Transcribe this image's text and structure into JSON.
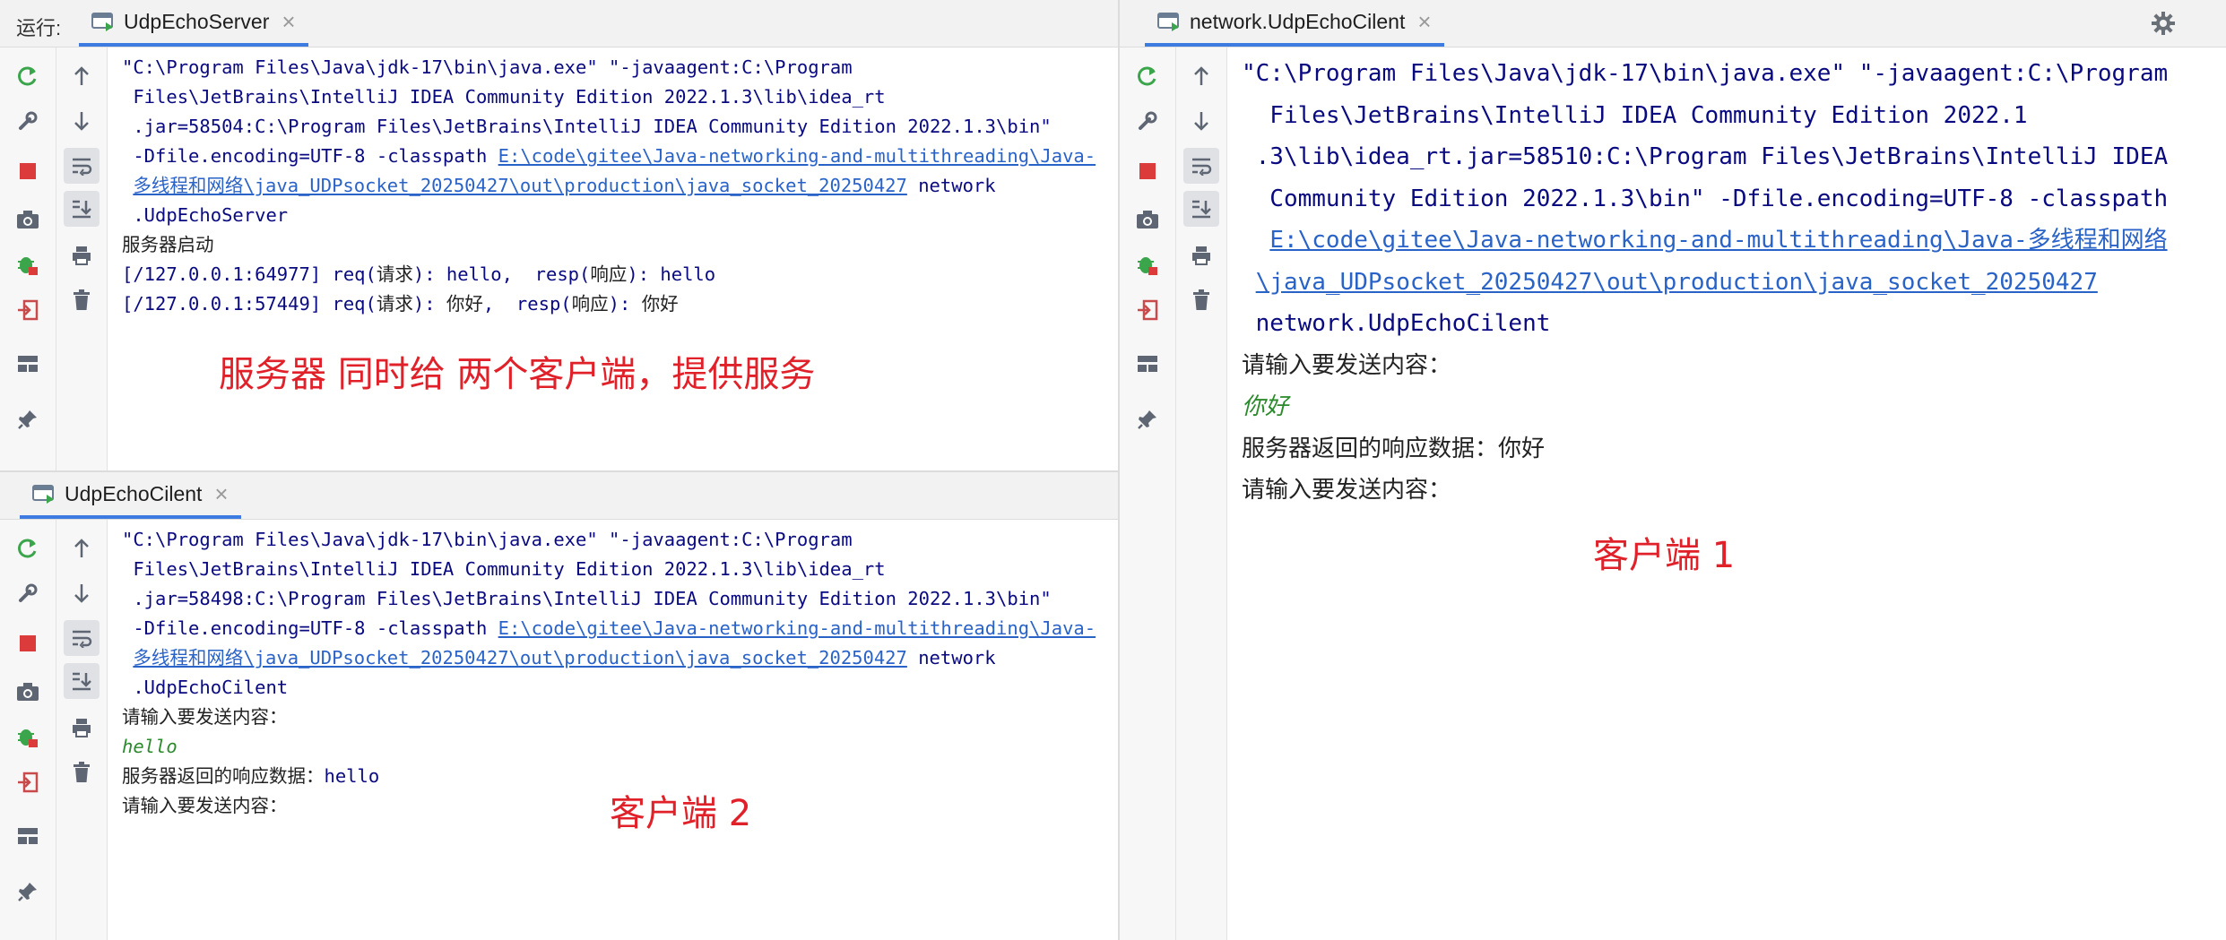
{
  "server_panel": {
    "run_label": "运行:",
    "tab_title": "UdpEchoServer",
    "console_lines": [
      [
        {
          "t": "\"C:\\Program Files\\Java\\jdk-17\\bin\\java.exe\" \"-javaagent:C:\\Program"
        }
      ],
      [
        {
          "t": " Files\\JetBrains\\IntelliJ IDEA Community Edition 2022.1.3\\lib\\idea_rt"
        }
      ],
      [
        {
          "t": " .jar=58504:C:\\Program Files\\JetBrains\\IntelliJ IDEA Community Edition 2022.1.3\\bin\""
        }
      ],
      [
        {
          "t": " -Dfile.encoding=UTF-8 -classpath "
        },
        {
          "t": "E:\\code\\gitee\\Java-networking-and-multithreading\\Java-",
          "c": "link"
        }
      ],
      [
        {
          "t": " "
        },
        {
          "t": "多线程和网络\\java_UDPsocket_20250427\\out\\production\\java_socket_20250427",
          "c": "link"
        },
        {
          "t": " network"
        }
      ],
      [
        {
          "t": " .UdpEchoServer"
        }
      ],
      [
        {
          "t": "服务器启动",
          "c": "cn"
        }
      ],
      [
        {
          "t": "[/127.0.0.1:64977] req(",
          "c": "plain"
        },
        {
          "t": "请求",
          "c": "cn"
        },
        {
          "t": "): hello,  resp(",
          "c": "plain"
        },
        {
          "t": "响应",
          "c": "cn"
        },
        {
          "t": "): hello",
          "c": "plain"
        }
      ],
      [
        {
          "t": "[/127.0.0.1:57449] req(",
          "c": "plain"
        },
        {
          "t": "请求",
          "c": "cn"
        },
        {
          "t": "): ",
          "c": "plain"
        },
        {
          "t": "你好",
          "c": "cn"
        },
        {
          "t": ",  resp(",
          "c": "plain"
        },
        {
          "t": "响应",
          "c": "cn"
        },
        {
          "t": "): ",
          "c": "plain"
        },
        {
          "t": "你好",
          "c": "cn"
        }
      ]
    ],
    "annotation": "服务器 同时给 两个客户端，提供服务"
  },
  "client2_panel": {
    "tab_title": "UdpEchoCilent",
    "console_lines": [
      [
        {
          "t": "\"C:\\Program Files\\Java\\jdk-17\\bin\\java.exe\" \"-javaagent:C:\\Program"
        }
      ],
      [
        {
          "t": " Files\\JetBrains\\IntelliJ IDEA Community Edition 2022.1.3\\lib\\idea_rt"
        }
      ],
      [
        {
          "t": " .jar=58498:C:\\Program Files\\JetBrains\\IntelliJ IDEA Community Edition 2022.1.3\\bin\""
        }
      ],
      [
        {
          "t": " -Dfile.encoding=UTF-8 -classpath "
        },
        {
          "t": "E:\\code\\gitee\\Java-networking-and-multithreading\\Java-",
          "c": "link"
        }
      ],
      [
        {
          "t": " "
        },
        {
          "t": "多线程和网络\\java_UDPsocket_20250427\\out\\production\\java_socket_20250427",
          "c": "link"
        },
        {
          "t": " network"
        }
      ],
      [
        {
          "t": " .UdpEchoCilent"
        }
      ],
      [
        {
          "t": "请输入要发送内容：",
          "c": "cn"
        }
      ],
      [
        {
          "t": "hello",
          "c": "green"
        }
      ],
      [
        {
          "t": "服务器返回的响应数据：",
          "c": "cn"
        },
        {
          "t": "hello",
          "c": "plain"
        }
      ],
      [
        {
          "t": "请输入要发送内容：",
          "c": "cn"
        }
      ]
    ],
    "annotation": "客户端 2"
  },
  "client1_panel": {
    "tab_title": "network.UdpEchoCilent",
    "console_lines": [
      [
        {
          "t": "\"C:\\Program Files\\Java\\jdk-17\\bin\\java.exe\" \"-javaagent:C:\\Program"
        }
      ],
      [
        {
          "t": "  Files\\JetBrains\\IntelliJ IDEA Community Edition 2022.1"
        }
      ],
      [
        {
          "t": " .3\\lib\\idea_rt.jar=58510:C:\\Program Files\\JetBrains\\IntelliJ IDEA"
        }
      ],
      [
        {
          "t": "  Community Edition 2022.1.3\\bin\" -Dfile.encoding=UTF-8 -classpath"
        }
      ],
      [
        {
          "t": "  "
        },
        {
          "t": "E:\\code\\gitee\\Java-networking-and-multithreading\\Java-多线程和网络",
          "c": "link"
        }
      ],
      [
        {
          "t": " "
        },
        {
          "t": "\\java_UDPsocket_20250427\\out\\production\\java_socket_20250427",
          "c": "link"
        }
      ],
      [
        {
          "t": " network.UdpEchoCilent"
        }
      ],
      [
        {
          "t": "请输入要发送内容：",
          "c": "cn"
        }
      ],
      [
        {
          "t": "你好",
          "c": "green"
        }
      ],
      [
        {
          "t": "服务器返回的响应数据：你好",
          "c": "cn"
        }
      ],
      [
        {
          "t": "请输入要发送内容：",
          "c": "cn"
        }
      ]
    ],
    "annotation": "客户端 1"
  },
  "toolbar_icons": {
    "tool1": [
      "rerun-icon",
      "wrench-icon",
      "stop-icon",
      "camera-icon",
      "debug-icon",
      "login-icon",
      "layout-icon",
      "pin-icon"
    ],
    "tool2": [
      "arrow-up-icon",
      "arrow-down-icon",
      "soft-wrap-icon",
      "scroll-to-end-icon",
      "print-icon",
      "trash-icon"
    ]
  },
  "colors": {
    "accent": "#3d7be0",
    "annotation": "#e0212a",
    "console_text": "#0a0a80",
    "link": "#2a63c8",
    "input_echo": "#2b8a2b"
  }
}
